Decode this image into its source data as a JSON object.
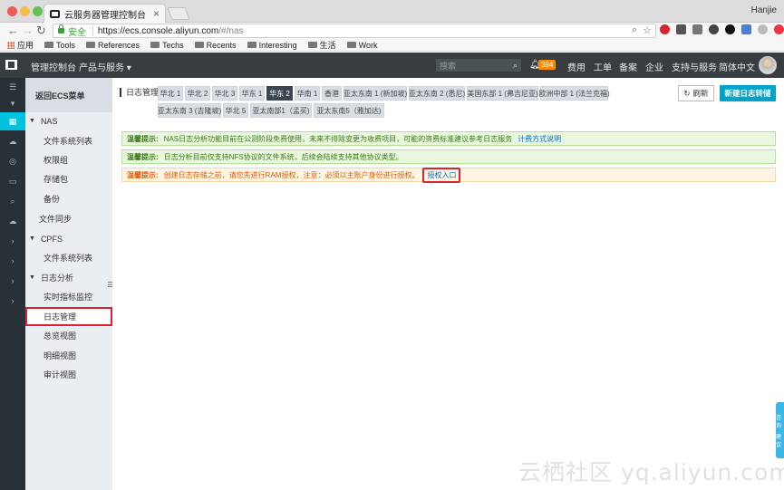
{
  "browser": {
    "tab_title": "云服务器管理控制台",
    "tab_close": "×",
    "profile": "Hanjie",
    "secure_label": "安全",
    "url_host": "https://ecs.console.aliyun.com",
    "url_path": "/#/nas",
    "bookmarks": [
      "应用",
      "Tools",
      "References",
      "Techs",
      "Recents",
      "Interesting",
      "生活",
      "Work"
    ]
  },
  "topnav": {
    "home": "管理控制台",
    "products": "产品与服务 ▾",
    "search_placeholder": "搜索",
    "badge": "394",
    "links": [
      "费用",
      "工单",
      "备案",
      "企业",
      "支持与服务",
      "简体中文"
    ]
  },
  "sidebar": {
    "back": "返回ECS菜单",
    "items": [
      {
        "label": "NAS",
        "type": "group"
      },
      {
        "label": "文件系统列表",
        "type": "sub"
      },
      {
        "label": "权限组",
        "type": "sub"
      },
      {
        "label": "存储包",
        "type": "sub"
      },
      {
        "label": "备份",
        "type": "sub"
      },
      {
        "label": "文件同步",
        "type": "plain"
      },
      {
        "label": "CPFS",
        "type": "group"
      },
      {
        "label": "文件系统列表",
        "type": "sub"
      },
      {
        "label": "日志分析",
        "type": "group"
      },
      {
        "label": "实时指标监控",
        "type": "sub"
      },
      {
        "label": "日志管理",
        "type": "sub"
      },
      {
        "label": "总览视图",
        "type": "sub"
      },
      {
        "label": "明细视图",
        "type": "sub"
      },
      {
        "label": "审计视图",
        "type": "sub"
      }
    ]
  },
  "main": {
    "title": "日志管理",
    "regions_row1": [
      "华北 1",
      "华北 2",
      "华北 3",
      "华东 1",
      "华东 2",
      "华南 1",
      "香港",
      "亚太东南 1 (新加坡)",
      "亚太东南 2 (悉尼)",
      "美国东部 1 (弗吉尼亚)",
      "欧洲中部 1 (法兰克福)"
    ],
    "regions_row2": [
      "亚太东南 3 (吉隆坡)",
      "华北 5",
      "亚太南部1（孟买)",
      "亚太东南5（雅加达)"
    ],
    "active_region": "华东 2",
    "refresh": "刷新",
    "create": "新建日志转储",
    "notices": [
      {
        "label": "温馨提示:",
        "text": "NAS日志分析功能目前在公测阶段免费使用，未来不排除变更为收费项目，可能的资费标准建议参考日志服务",
        "link": "计费方式说明"
      },
      {
        "label": "温馨提示:",
        "text": "日志分析目前仅支持NFS协议的文件系统，后续会陆续支持其他协议类型。",
        "link": ""
      },
      {
        "label": "温馨提示:",
        "text": "创建日志存储之前，请您先进行RAM授权，注意：必须以主账户身份进行授权。",
        "link": "授权入口"
      }
    ]
  },
  "helper": [
    "咨询",
    "建议"
  ],
  "watermark": "云栖社区 yq.aliyun.com"
}
